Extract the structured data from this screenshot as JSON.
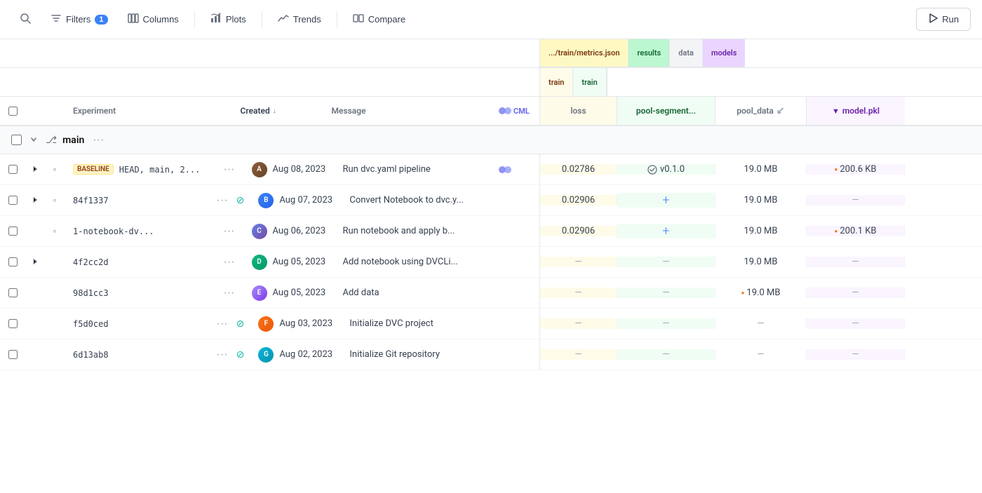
{
  "toolbar": {
    "search_label": "Search",
    "filters_label": "Filters",
    "filters_count": "1",
    "columns_label": "Columns",
    "plots_label": "Plots",
    "trends_label": "Trends",
    "compare_label": "Compare",
    "run_label": "Run"
  },
  "table": {
    "columns_left": {
      "experiment": "Experiment",
      "created": "Created",
      "message": "Message",
      "cml": "CML"
    },
    "columns_right": {
      "group1_path": ".../train/metrics.json",
      "group1_subgroup": "train",
      "group1_col": "loss",
      "group2_path": "results",
      "group2_subgroup": "train",
      "group2_col": "pool-segment...",
      "group3_path": "data",
      "group3_col": "pool_data",
      "group4_path": "models",
      "group4_col": "model.pkl"
    },
    "section_main": {
      "branch_name": "main",
      "expand_state": "expanded"
    },
    "rows": [
      {
        "id": "head-main",
        "tags": [
          "BASELINE"
        ],
        "experiment": "HEAD, main, 2...",
        "created": "Aug 08, 2023",
        "message": "Run dvc.yaml pipeline",
        "cml": true,
        "loss": "0.02786",
        "version": "v0.1.0",
        "has_version": true,
        "pool_segment": "",
        "pool_data": "19.0 MB",
        "pool_data_has_dot": false,
        "model_pkl": "200.6 KB",
        "model_has_dot": true,
        "model_dot_color": "orange"
      },
      {
        "id": "84f1337",
        "tags": [],
        "experiment": "84f1337",
        "created": "Aug 07, 2023",
        "message": "Convert Notebook to dvc.y...",
        "cml": false,
        "has_strikethrough": true,
        "loss": "0.02906",
        "version": "",
        "has_version": false,
        "pool_segment": "plus",
        "pool_data": "19.0 MB",
        "pool_data_has_dot": false,
        "model_pkl": "",
        "model_has_dot": false
      },
      {
        "id": "1-notebook-dv...",
        "tags": [],
        "experiment": "1-notebook-dv...",
        "created": "Aug 06, 2023",
        "message": "Run notebook and apply b...",
        "cml": false,
        "loss": "0.02906",
        "version": "",
        "has_version": false,
        "pool_segment": "plus",
        "pool_data": "19.0 MB",
        "pool_data_has_dot": false,
        "model_pkl": "200.1 KB",
        "model_has_dot": true,
        "model_dot_color": "orange"
      },
      {
        "id": "4f2cc2d",
        "tags": [],
        "experiment": "4f2cc2d",
        "created": "Aug 05, 2023",
        "message": "Add notebook using DVCLi...",
        "cml": false,
        "loss": "—",
        "version": "",
        "has_version": false,
        "pool_segment": "—",
        "pool_data": "19.0 MB",
        "pool_data_has_dot": false,
        "model_pkl": "—",
        "model_has_dot": false,
        "has_expand": true
      },
      {
        "id": "98d1cc3",
        "tags": [],
        "experiment": "98d1cc3",
        "created": "Aug 05, 2023",
        "message": "Add data",
        "cml": false,
        "loss": "—",
        "version": "",
        "has_version": false,
        "pool_segment": "—",
        "pool_data": "19.0 MB",
        "pool_data_has_dot": true,
        "pool_data_dot_color": "orange",
        "model_pkl": "—",
        "model_has_dot": false
      },
      {
        "id": "f5d0ced",
        "tags": [],
        "experiment": "f5d0ced",
        "created": "Aug 03, 2023",
        "message": "Initialize DVC project",
        "cml": false,
        "has_strikethrough": true,
        "loss": "—",
        "version": "",
        "has_version": false,
        "pool_segment": "—",
        "pool_data": "—",
        "pool_data_has_dot": false,
        "model_pkl": "—",
        "model_has_dot": false
      },
      {
        "id": "6d13ab8",
        "tags": [],
        "experiment": "6d13ab8",
        "created": "Aug 02, 2023",
        "message": "Initialize Git repository",
        "cml": false,
        "has_strikethrough": true,
        "loss": "—",
        "version": "",
        "has_version": false,
        "pool_segment": "—",
        "pool_data": "—",
        "pool_data_has_dot": false,
        "model_pkl": "—",
        "model_has_dot": false
      }
    ]
  }
}
